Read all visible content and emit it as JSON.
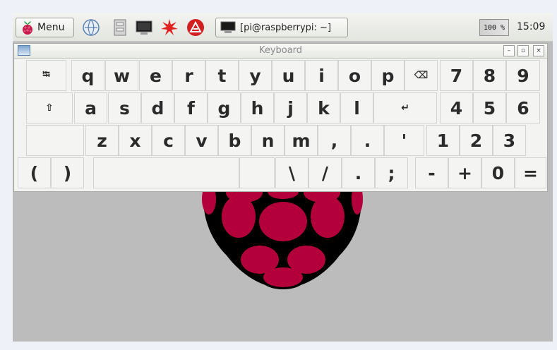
{
  "taskbar": {
    "menu_label": "Menu",
    "launchers": [
      "web-browser-icon",
      "file-manager-icon",
      "terminal-icon",
      "math-icon",
      "wolfram-icon"
    ],
    "task_label": "[pi@raspberrypi: ~]",
    "cpu_label": "100 %",
    "clock": "15:09"
  },
  "window": {
    "title": "Keyboard",
    "minimize": "–",
    "maximize": "▫",
    "close": "×"
  },
  "keys": {
    "row1": [
      "⭾",
      "q",
      "w",
      "e",
      "r",
      "t",
      "y",
      "u",
      "i",
      "o",
      "p",
      "⌫",
      "7",
      "8",
      "9"
    ],
    "row2": [
      "⇧",
      "a",
      "s",
      "d",
      "f",
      "g",
      "h",
      "j",
      "k",
      "l",
      "↵",
      "4",
      "5",
      "6"
    ],
    "row3": [
      "",
      "z",
      "x",
      "c",
      "v",
      "b",
      "n",
      "m",
      ",",
      ".",
      "'",
      "1",
      "2",
      "3"
    ],
    "row4": [
      "(",
      ")",
      "",
      "",
      "\\",
      "/",
      ".",
      ";",
      "-",
      "+",
      "0",
      "="
    ]
  },
  "colors": {
    "desktop": "#bcbcbc",
    "raspberry": "#b3003c",
    "leaf": "#000000"
  }
}
